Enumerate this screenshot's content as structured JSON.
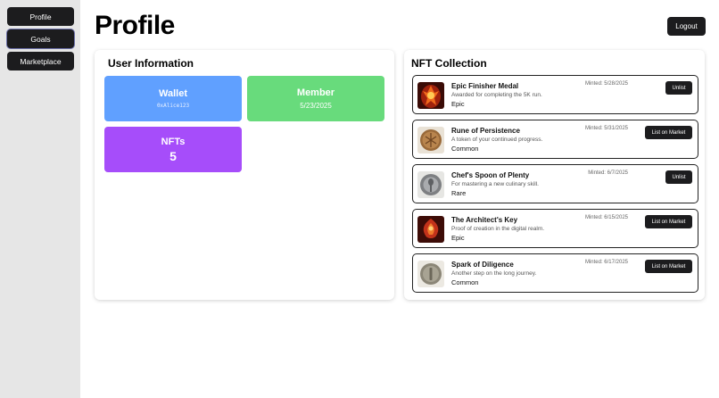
{
  "sidebar": {
    "items": [
      {
        "label": "Profile"
      },
      {
        "label": "Goals"
      },
      {
        "label": "Marketplace"
      }
    ]
  },
  "header": {
    "title": "Profile",
    "logout_label": "Logout"
  },
  "user_info": {
    "title": "User Information",
    "wallet": {
      "label": "Wallet",
      "address": "0xAlice123"
    },
    "member": {
      "label": "Member",
      "date": "5/23/2025"
    },
    "nfts": {
      "label": "NFTs",
      "count": "5"
    }
  },
  "colors": {
    "wallet_card": "#60a0ff",
    "member_card": "#68db7c",
    "nfts_card": "#a64dfa",
    "button_dark": "#1c1c1e"
  },
  "nft_collection": {
    "title": "NFT Collection",
    "items": [
      {
        "name": "Epic Finisher Medal",
        "description": "Awarded for completing the 5K run.",
        "rarity": "Epic",
        "minted": "Minted: 5/28/2025",
        "action": "Unlist",
        "icon": "flaming-medal-icon"
      },
      {
        "name": "Rune of Persistence",
        "description": "A token of your continued progress.",
        "rarity": "Common",
        "minted": "Minted: 5/31/2025",
        "action": "List on Market",
        "icon": "bronze-rune-coin-icon"
      },
      {
        "name": "Chef's Spoon of Plenty",
        "description": "For mastering a new culinary skill.",
        "rarity": "Rare",
        "minted": "Minted: 6/7/2025",
        "action": "Unlist",
        "icon": "silver-spoon-medal-icon"
      },
      {
        "name": "The Architect's Key",
        "description": "Proof of creation in the digital realm.",
        "rarity": "Epic",
        "minted": "Minted: 6/15/2025",
        "action": "List on Market",
        "icon": "flaming-key-icon"
      },
      {
        "name": "Spark of Diligence",
        "description": "Another step on the long journey.",
        "rarity": "Common",
        "minted": "Minted: 6/17/2025",
        "action": "List on Market",
        "icon": "stone-spark-token-icon"
      }
    ]
  }
}
